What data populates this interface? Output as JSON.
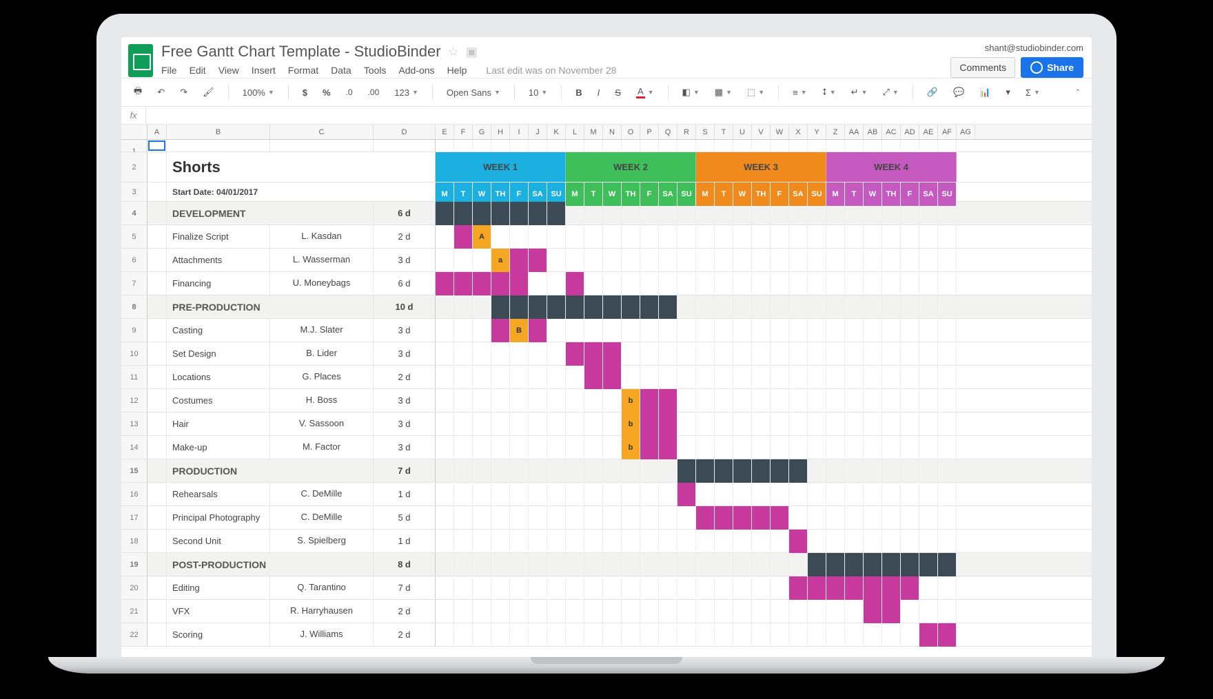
{
  "header": {
    "doc_title": "Free Gantt Chart Template - StudioBinder",
    "user_email": "shant@studiobinder.com",
    "comments_btn": "Comments",
    "share_btn": "Share",
    "last_edit": "Last edit was on November 28",
    "menus": [
      "File",
      "Edit",
      "View",
      "Insert",
      "Format",
      "Data",
      "Tools",
      "Add-ons",
      "Help"
    ]
  },
  "toolbar": {
    "zoom": "100%",
    "font": "Open Sans",
    "fontsize": "10",
    "numfmt": "123"
  },
  "fx_label": "fx",
  "columns_left": [
    "A",
    "B",
    "C",
    "D"
  ],
  "columns_days": [
    "E",
    "F",
    "G",
    "H",
    "I",
    "J",
    "K",
    "L",
    "M",
    "N",
    "O",
    "P",
    "Q",
    "R",
    "S",
    "T",
    "U",
    "V",
    "W",
    "X",
    "Y",
    "Z",
    "AA",
    "AB",
    "AC",
    "AD",
    "AE",
    "AF",
    "AG"
  ],
  "weeks": [
    {
      "label": "WEEK 1",
      "color": "c-w1"
    },
    {
      "label": "WEEK 2",
      "color": "c-w2"
    },
    {
      "label": "WEEK 3",
      "color": "c-w3"
    },
    {
      "label": "WEEK 4",
      "color": "c-w4"
    }
  ],
  "day_headers": [
    "M",
    "T",
    "W",
    "TH",
    "F",
    "SA",
    "SU"
  ],
  "sheet_title": "Shorts",
  "start_date_label": "Start Date: 04/01/2017",
  "chart_data": {
    "type": "gantt",
    "unit": "days",
    "title": "Shorts",
    "start_date": "04/01/2017",
    "x_axis": {
      "weeks": [
        "WEEK 1",
        "WEEK 2",
        "WEEK 3",
        "WEEK 4"
      ],
      "days_per_week": [
        "M",
        "T",
        "W",
        "TH",
        "F",
        "SA",
        "SU"
      ],
      "total_days": 28
    },
    "sections": [
      {
        "name": "DEVELOPMENT",
        "duration": "6 d",
        "bar_start": 1,
        "bar_end": 7,
        "row": 4,
        "tasks": [
          {
            "row": 5,
            "name": "Finalize Script",
            "owner": "L. Kasdan",
            "duration": "2 d",
            "bars": [
              {
                "start": 2,
                "end": 2,
                "style": "pink"
              }
            ],
            "milestones": [
              {
                "day": 3,
                "label": "A"
              }
            ]
          },
          {
            "row": 6,
            "name": "Attachments",
            "owner": "L. Wasserman",
            "duration": "3 d",
            "bars": [
              {
                "start": 5,
                "end": 6,
                "style": "pink"
              }
            ],
            "milestones": [
              {
                "day": 4,
                "label": "a"
              }
            ]
          },
          {
            "row": 7,
            "name": "Financing",
            "owner": "U. Moneybags",
            "duration": "6 d",
            "bars": [
              {
                "start": 1,
                "end": 5,
                "style": "pink"
              },
              {
                "start": 8,
                "end": 8,
                "style": "pink"
              }
            ]
          }
        ]
      },
      {
        "name": "PRE-PRODUCTION",
        "duration": "10 d",
        "bar_start": 4,
        "bar_end": 13,
        "row": 8,
        "tasks": [
          {
            "row": 9,
            "name": "Casting",
            "owner": "M.J. Slater",
            "duration": "3 d",
            "bars": [
              {
                "start": 4,
                "end": 4,
                "style": "pink"
              },
              {
                "start": 6,
                "end": 6,
                "style": "pink"
              }
            ],
            "milestones": [
              {
                "day": 5,
                "label": "B"
              }
            ]
          },
          {
            "row": 10,
            "name": "Set Design",
            "owner": "B. Lider",
            "duration": "3 d",
            "bars": [
              {
                "start": 8,
                "end": 10,
                "style": "pink"
              }
            ]
          },
          {
            "row": 11,
            "name": "Locations",
            "owner": "G. Places",
            "duration": "2 d",
            "bars": [
              {
                "start": 9,
                "end": 10,
                "style": "pink"
              }
            ]
          },
          {
            "row": 12,
            "name": "Costumes",
            "owner": "H. Boss",
            "duration": "3 d",
            "bars": [
              {
                "start": 12,
                "end": 13,
                "style": "pink"
              }
            ],
            "milestones": [
              {
                "day": 11,
                "label": "b"
              }
            ]
          },
          {
            "row": 13,
            "name": "Hair",
            "owner": "V. Sassoon",
            "duration": "3 d",
            "bars": [
              {
                "start": 12,
                "end": 13,
                "style": "pink"
              }
            ],
            "milestones": [
              {
                "day": 11,
                "label": "b"
              }
            ]
          },
          {
            "row": 14,
            "name": "Make-up",
            "owner": "M. Factor",
            "duration": "3 d",
            "bars": [
              {
                "start": 12,
                "end": 13,
                "style": "pink"
              }
            ],
            "milestones": [
              {
                "day": 11,
                "label": "b"
              }
            ]
          }
        ]
      },
      {
        "name": "PRODUCTION",
        "duration": "7 d",
        "bar_start": 14,
        "bar_end": 20,
        "row": 15,
        "tasks": [
          {
            "row": 16,
            "name": "Rehearsals",
            "owner": "C. DeMille",
            "duration": "1 d",
            "bars": [
              {
                "start": 14,
                "end": 14,
                "style": "pink"
              }
            ]
          },
          {
            "row": 17,
            "name": "Principal Photography",
            "owner": "C. DeMille",
            "duration": "5 d",
            "bars": [
              {
                "start": 15,
                "end": 19,
                "style": "pink"
              }
            ]
          },
          {
            "row": 18,
            "name": "Second Unit",
            "owner": "S. Spielberg",
            "duration": "1 d",
            "bars": [
              {
                "start": 20,
                "end": 20,
                "style": "pink"
              }
            ]
          }
        ]
      },
      {
        "name": "POST-PRODUCTION",
        "duration": "8 d",
        "bar_start": 21,
        "bar_end": 28,
        "row": 19,
        "tasks": [
          {
            "row": 20,
            "name": "Editing",
            "owner": "Q. Tarantino",
            "duration": "7 d",
            "bars": [
              {
                "start": 20,
                "end": 26,
                "style": "pink"
              }
            ]
          },
          {
            "row": 21,
            "name": "VFX",
            "owner": "R. Harryhausen",
            "duration": "2 d",
            "bars": [
              {
                "start": 24,
                "end": 25,
                "style": "pink"
              }
            ]
          },
          {
            "row": 22,
            "name": "Scoring",
            "owner": "J. Williams",
            "duration": "2 d",
            "bars": [
              {
                "start": 27,
                "end": 28,
                "style": "pink"
              }
            ]
          }
        ]
      }
    ]
  }
}
